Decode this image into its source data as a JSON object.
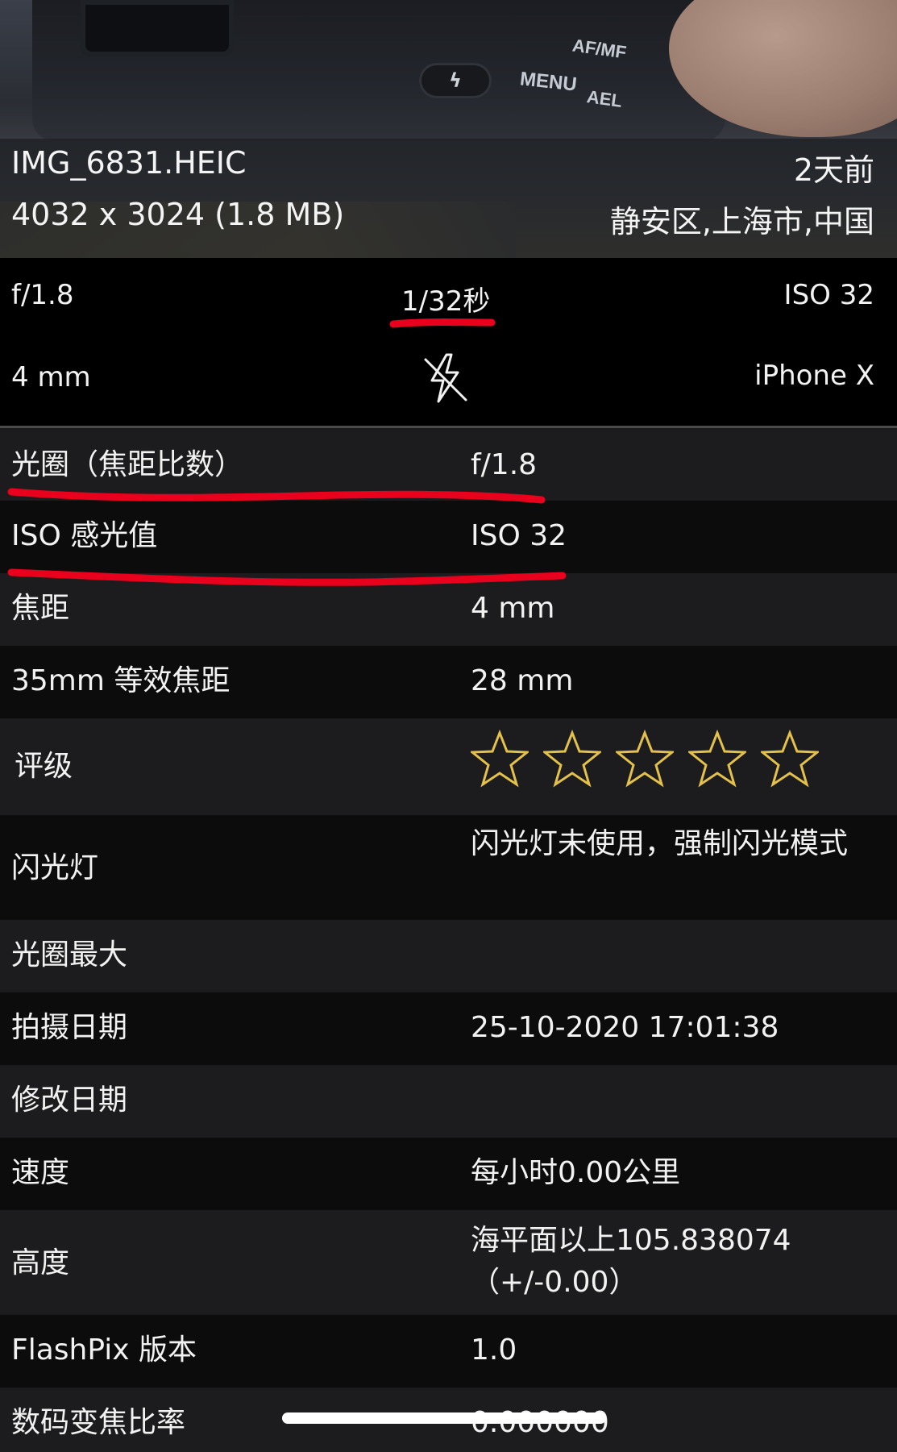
{
  "file": {
    "name": "IMG_6831.HEIC",
    "dimensions": "4032 x 3024 (1.8 MB)",
    "age": "2天前",
    "location": "静安区,上海市,中国"
  },
  "photo_labels": {
    "menu": "MENU",
    "af": "AF/MF",
    "ael": "AEL",
    "flash": "ϟ"
  },
  "summary": {
    "aperture": "f/1.8",
    "shutter": "1/32秒",
    "iso": "ISO 32",
    "focal": "4 mm",
    "flash_icon": "flash-off-icon",
    "model": "iPhone X"
  },
  "details": {
    "aperture": {
      "key": "光圈（焦距比数）",
      "value": "f/1.8"
    },
    "iso": {
      "key": "ISO 感光值",
      "value": "ISO 32"
    },
    "focal": {
      "key": "焦距",
      "value": "4 mm"
    },
    "focal35": {
      "key": "35mm 等效焦距",
      "value": "28 mm"
    },
    "rating": {
      "key": "评级",
      "stars": 0,
      "max": 5
    },
    "flash": {
      "key": "闪光灯",
      "value": "闪光灯未使用，强制闪光模式"
    },
    "max_aperture": {
      "key": "光圈最大",
      "value": ""
    },
    "date_taken": {
      "key": "拍摄日期",
      "value": "25-10-2020 17:01:38"
    },
    "date_modified": {
      "key": "修改日期",
      "value": ""
    },
    "speed": {
      "key": "速度",
      "value": "每小时0.00公里"
    },
    "altitude": {
      "key": "高度",
      "value": "海平面以上105.838074（+/-0.00）"
    },
    "flashpix": {
      "key": "FlashPix 版本",
      "value": "1.0"
    },
    "zoom": {
      "key": "数码变焦比率",
      "value": "0.000000"
    }
  },
  "colors": {
    "annotation": "#e8001c",
    "star": "#e3c14a",
    "row_light": "#1c1c1e",
    "row_dark": "#0c0c0c"
  }
}
